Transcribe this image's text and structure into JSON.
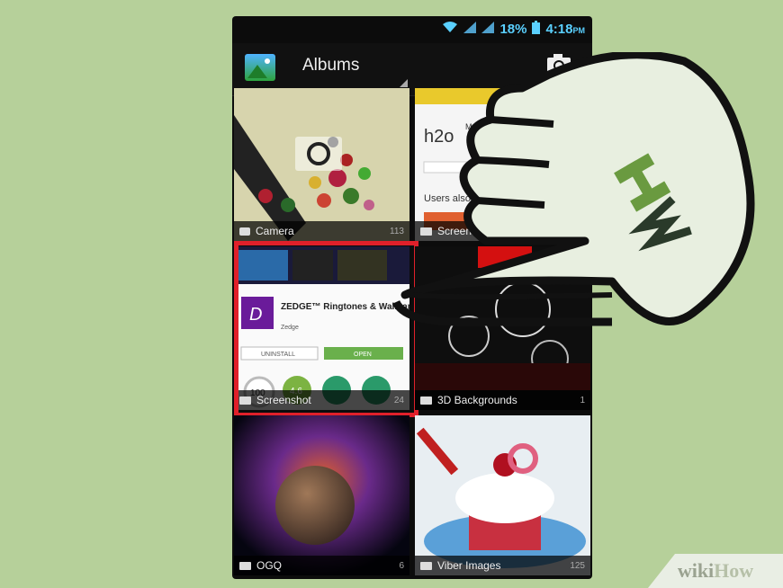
{
  "status_bar": {
    "battery": "18%",
    "time": "4:18",
    "ampm": "PM"
  },
  "action_bar": {
    "title": "Albums"
  },
  "albums": [
    {
      "name": "Camera",
      "count": "113"
    },
    {
      "name": "Screensho",
      "count": ""
    },
    {
      "name": "Screenshot",
      "count": "24"
    },
    {
      "name": "3D Backgrounds",
      "count": "1"
    },
    {
      "name": "OGQ",
      "count": "6"
    },
    {
      "name": "Viber Images",
      "count": "125"
    }
  ],
  "play_store_preview": {
    "app_title": "ZEDGE™ Ringtones & Wallpapers",
    "developer": "Zedge",
    "uninstall": "UNINSTALL",
    "open": "OPEN",
    "stat1": "100",
    "stat2": "4.6",
    "h2o_title": "MyH2O",
    "also_installed": "Users also installed"
  },
  "watermark": {
    "part1": "wiki",
    "part2": "How"
  },
  "colors": {
    "selection": "#e0202a",
    "status_blue": "#5ad0ff",
    "background": "#b6d09a"
  }
}
